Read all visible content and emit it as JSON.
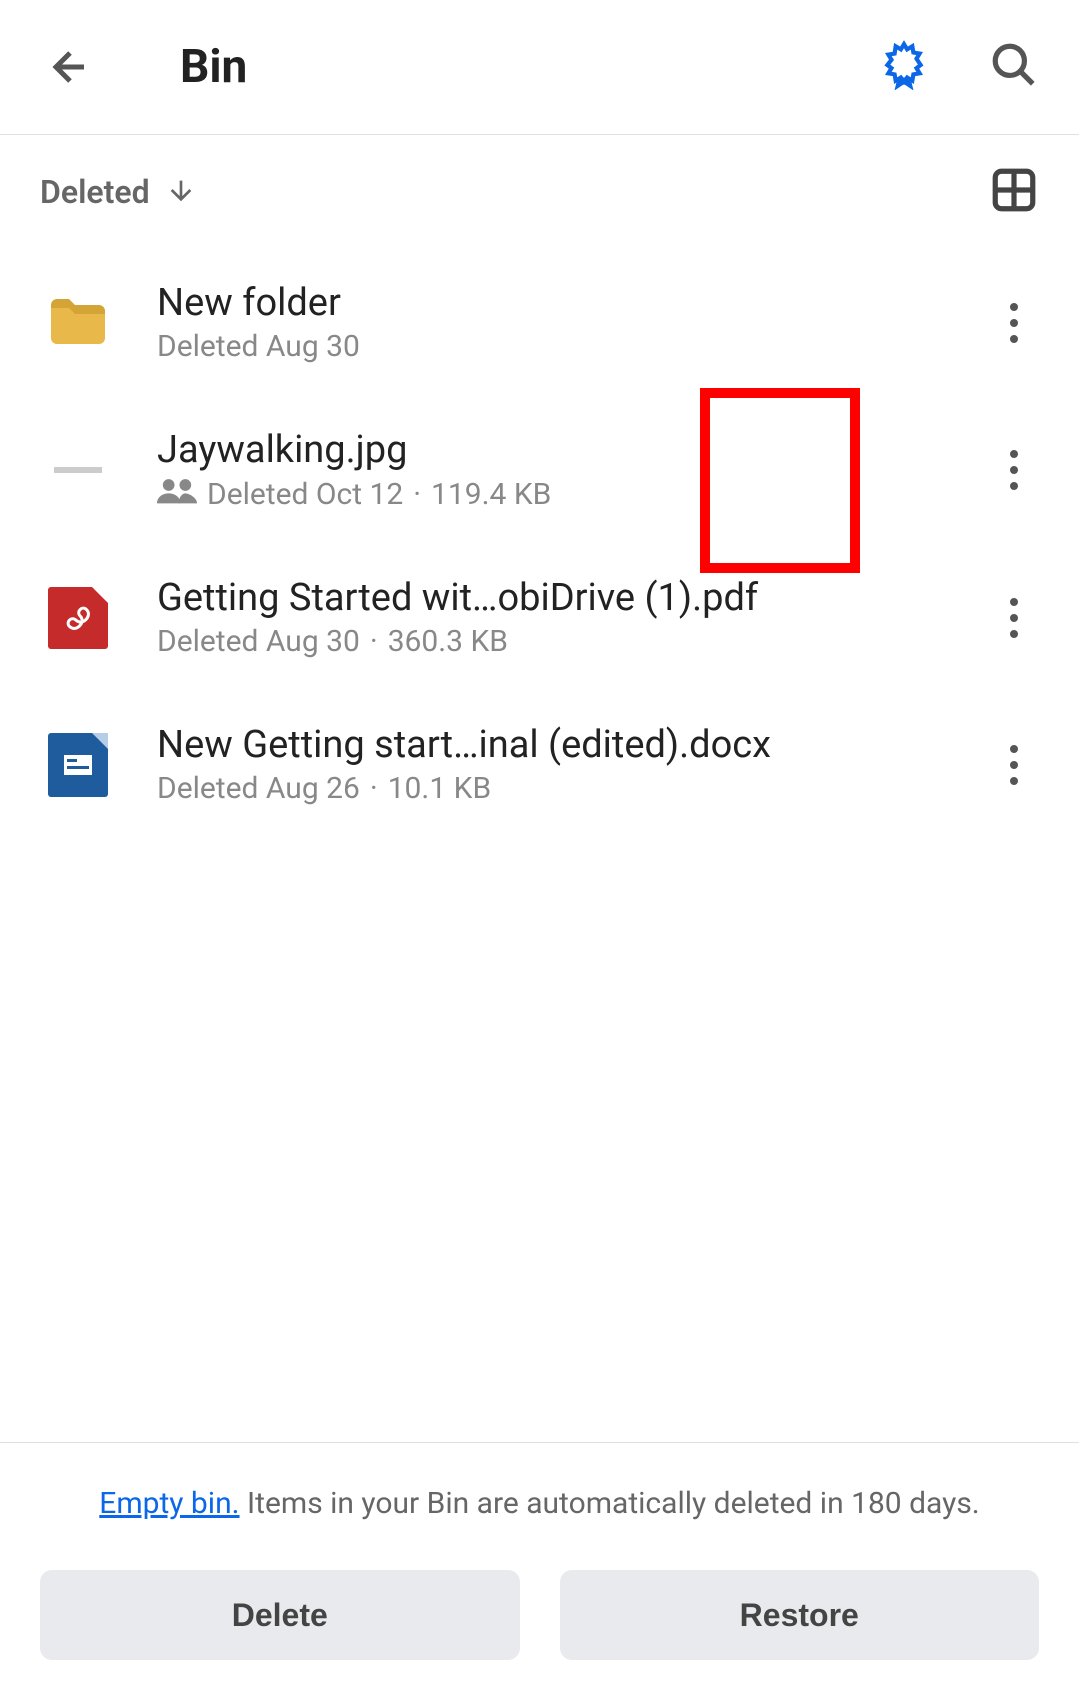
{
  "header": {
    "title": "Bin"
  },
  "sort": {
    "label": "Deleted"
  },
  "items": [
    {
      "name": "New folder",
      "meta_deleted": "Deleted Aug 30",
      "size": "",
      "shared": false,
      "type": "folder"
    },
    {
      "name": "Jaywalking.jpg",
      "meta_deleted": "Deleted Oct 12",
      "size": "119.4 KB",
      "shared": true,
      "type": "image"
    },
    {
      "name": "Getting Started wit…obiDrive (1).pdf",
      "meta_deleted": "Deleted Aug 30",
      "size": "360.3 KB",
      "shared": false,
      "type": "pdf"
    },
    {
      "name": "New Getting start…inal (edited).docx",
      "meta_deleted": "Deleted Aug 26",
      "size": "10.1 KB",
      "shared": false,
      "type": "docx"
    }
  ],
  "footer": {
    "link_text": "Empty bin.",
    "info_text": " Items in your Bin are automatically deleted in 180 days.",
    "delete_label": "Delete",
    "restore_label": "Restore"
  }
}
